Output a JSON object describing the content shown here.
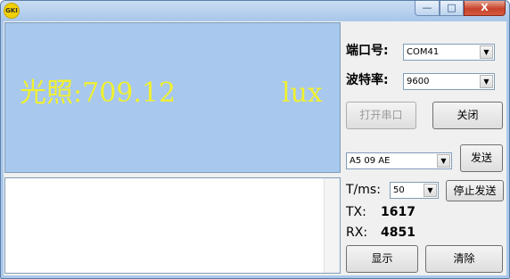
{
  "window": {
    "icon_text": "GKI",
    "controls": {
      "minimize": "—",
      "maximize": "□",
      "close": "X"
    }
  },
  "display": {
    "label": "光照:",
    "value": "709.12",
    "unit": "lux"
  },
  "panel": {
    "port_label": "端口号:",
    "port_value": "COM41",
    "baud_label": "波特率:",
    "baud_value": "9600",
    "open_port_button": "打开串口",
    "close_port_button": "关闭",
    "send_data_value": "A5 09 AE",
    "send_button": "发送",
    "interval_label": "T/ms:",
    "interval_value": "50",
    "stop_send_button": "停止发送",
    "tx_label": "TX:",
    "tx_value": "1617",
    "rx_label": "RX:",
    "rx_value": "4851",
    "show_button": "显示",
    "clear_button": "清除"
  },
  "icons": {
    "dropdown": "chevron-down-icon"
  }
}
